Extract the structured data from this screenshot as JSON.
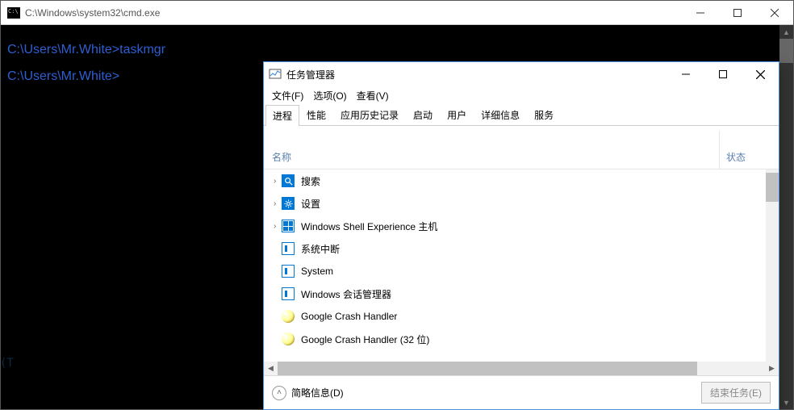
{
  "cmd": {
    "title": "C:\\Windows\\system32\\cmd.exe",
    "line1": "C:\\Users\\Mr.White>taskmgr",
    "line2": "C:\\Users\\Mr.White>",
    "truncated": "(T"
  },
  "tm": {
    "title": "任务管理器",
    "menu": {
      "file": "文件(F)",
      "options": "选项(O)",
      "view": "查看(V)"
    },
    "tabs": [
      "进程",
      "性能",
      "应用历史记录",
      "启动",
      "用户",
      "详细信息",
      "服务"
    ],
    "cols": {
      "name": "名称",
      "status": "状态"
    },
    "rows": [
      {
        "expand": true,
        "icon": "search",
        "label": "搜索"
      },
      {
        "expand": true,
        "icon": "gear",
        "label": "设置"
      },
      {
        "expand": true,
        "icon": "win",
        "label": "Windows Shell Experience 主机"
      },
      {
        "expand": false,
        "icon": "sys",
        "label": "系统中断"
      },
      {
        "expand": false,
        "icon": "sys",
        "label": "System"
      },
      {
        "expand": false,
        "icon": "sys",
        "label": "Windows 会话管理器"
      },
      {
        "expand": false,
        "icon": "crash",
        "label": "Google Crash Handler"
      },
      {
        "expand": false,
        "icon": "crash",
        "label": "Google Crash Handler (32 位)"
      }
    ],
    "footer": {
      "fewer": "简略信息(D)",
      "endtask": "结束任务(E)"
    }
  }
}
